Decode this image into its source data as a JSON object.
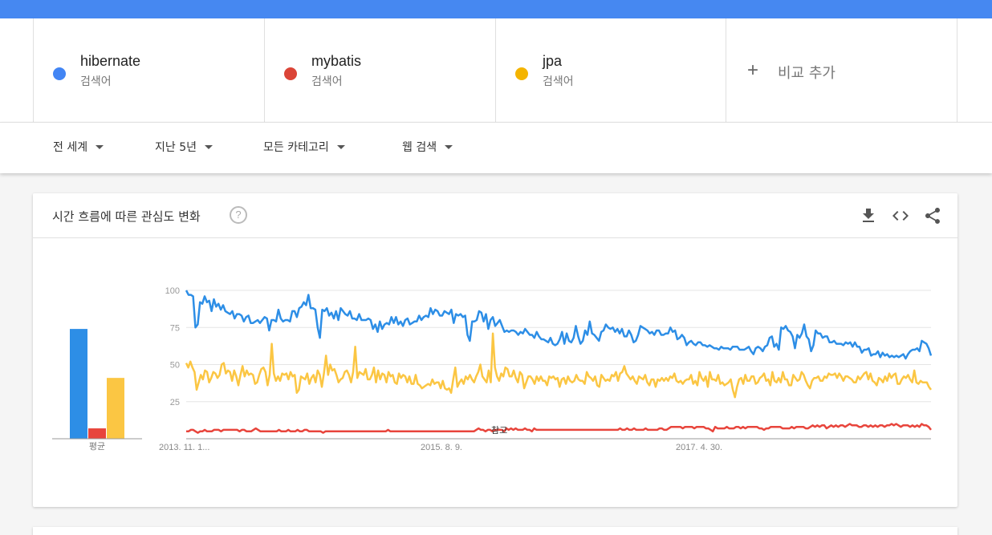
{
  "terms": [
    {
      "name": "hibernate",
      "type": "검색어",
      "color": "#4285f4"
    },
    {
      "name": "mybatis",
      "type": "검색어",
      "color": "#db4437"
    },
    {
      "name": "jpa",
      "type": "검색어",
      "color": "#f4b400"
    }
  ],
  "add_compare": {
    "plus": "+",
    "label": "비교 추가"
  },
  "filters": {
    "region": "전 세계",
    "time": "지난 5년",
    "category": "모든 카테고리",
    "search_type": "웹 검색"
  },
  "card": {
    "title": "시간 흐름에 따른 관심도 변화",
    "help": "?",
    "icons": [
      "download-icon",
      "embed-code-icon",
      "share-icon"
    ]
  },
  "chart_data": {
    "type": "line",
    "x_tick_labels": [
      "2013. 11. 1...",
      "2015. 8. 9.",
      "2017. 4. 30."
    ],
    "y_ticks": [
      25,
      50,
      75,
      100
    ],
    "ylim": [
      0,
      100
    ],
    "note_label": "참고",
    "average_label": "평균",
    "averages": [
      {
        "term": "hibernate",
        "value": 74,
        "color": "#2d8ee6"
      },
      {
        "term": "mybatis",
        "value": 7,
        "color": "#e8453c"
      },
      {
        "term": "jpa",
        "value": 41,
        "color": "#fbc643"
      }
    ],
    "series": [
      {
        "name": "hibernate",
        "color": "#2d8ee6",
        "values": [
          100,
          97,
          97,
          96,
          75,
          77,
          92,
          91,
          96,
          92,
          93,
          86,
          94,
          89,
          91,
          87,
          90,
          86,
          85,
          84,
          86,
          81,
          84,
          84,
          83,
          79,
          82,
          83,
          78,
          78,
          79,
          80,
          78,
          80,
          82,
          81,
          73,
          80,
          80,
          79,
          87,
          81,
          79,
          80,
          80,
          79,
          86,
          86,
          82,
          88,
          89,
          92,
          90,
          97,
          88,
          88,
          87,
          75,
          68,
          87,
          86,
          88,
          83,
          85,
          81,
          86,
          80,
          88,
          86,
          84,
          83,
          86,
          81,
          81,
          80,
          84,
          80,
          80,
          80,
          81,
          80,
          74,
          77,
          72,
          79,
          74,
          77,
          78,
          77,
          82,
          78,
          82,
          77,
          79,
          76,
          80,
          81,
          77,
          78,
          79,
          79,
          83,
          80,
          82,
          83,
          82,
          88,
          84,
          87,
          86,
          83,
          83,
          86,
          85,
          84,
          87,
          78,
          84,
          83,
          84,
          82,
          83,
          70,
          66,
          79,
          79,
          80,
          86,
          85,
          79,
          84,
          74,
          80,
          82,
          76,
          78,
          80,
          76,
          72,
          73,
          72,
          73,
          73,
          72,
          70,
          72,
          71,
          74,
          72,
          70,
          70,
          68,
          72,
          69,
          67,
          67,
          66,
          65,
          68,
          64,
          63,
          64,
          67,
          72,
          64,
          71,
          66,
          65,
          68,
          76,
          69,
          64,
          66,
          73,
          70,
          79,
          71,
          70,
          68,
          66,
          72,
          73,
          77,
          75,
          74,
          75,
          72,
          74,
          71,
          74,
          69,
          69,
          73,
          70,
          65,
          66,
          70,
          76,
          75,
          74,
          73,
          71,
          72,
          70,
          73,
          73,
          70,
          70,
          71,
          71,
          75,
          72,
          73,
          67,
          68,
          70,
          68,
          63,
          65,
          66,
          64,
          63,
          65,
          65,
          63,
          63,
          62,
          63,
          62,
          61,
          61,
          60,
          62,
          61,
          61,
          61,
          60,
          62,
          62,
          62,
          60,
          60,
          60,
          61,
          62,
          59,
          57,
          61,
          62,
          61,
          59,
          62,
          63,
          68,
          69,
          62,
          64,
          60,
          75,
          74,
          76,
          73,
          72,
          69,
          61,
          70,
          68,
          71,
          77,
          69,
          67,
          59,
          63,
          73,
          71,
          71,
          68,
          69,
          69,
          65,
          65,
          66,
          64,
          64,
          64,
          63,
          65,
          64,
          65,
          62,
          65,
          62,
          62,
          58,
          60,
          60,
          61,
          56,
          57,
          57,
          59,
          55,
          58,
          56,
          57,
          55,
          56,
          55,
          56,
          55,
          56,
          57,
          54,
          57,
          59,
          60,
          60,
          61,
          59,
          66,
          65,
          64,
          61,
          56
        ]
      },
      {
        "name": "mybatis",
        "color": "#e8453c",
        "values": [
          5,
          5,
          6,
          6,
          5,
          4,
          5,
          5,
          6,
          5,
          5,
          5,
          6,
          6,
          6,
          5,
          6,
          6,
          6,
          6,
          6,
          6,
          6,
          5,
          6,
          6,
          5,
          5,
          5,
          6,
          7,
          6,
          5,
          5,
          5,
          5,
          5,
          5,
          5,
          5,
          6,
          5,
          5,
          5,
          6,
          5,
          5,
          5,
          6,
          5,
          5,
          6,
          6,
          5,
          5,
          5,
          5,
          5,
          5,
          4,
          5,
          5,
          5,
          5,
          5,
          5,
          5,
          5,
          5,
          5,
          5,
          5,
          5,
          5,
          5,
          5,
          5,
          5,
          5,
          5,
          5,
          5,
          5,
          5,
          5,
          5,
          5,
          6,
          5,
          5,
          5,
          5,
          5,
          5,
          5,
          5,
          5,
          5,
          5,
          5,
          5,
          5,
          5,
          5,
          5,
          5,
          5,
          5,
          5,
          5,
          5,
          5,
          5,
          5,
          5,
          5,
          5,
          5,
          5,
          5,
          5,
          5,
          5,
          5,
          5,
          6,
          7,
          6,
          6,
          5,
          6,
          6,
          5,
          6,
          6,
          6,
          6,
          5,
          7,
          6,
          7,
          6,
          7,
          6,
          6,
          6,
          7,
          6,
          6,
          5,
          7,
          6,
          6,
          6,
          6,
          6,
          6,
          6,
          6,
          6,
          6,
          6,
          6,
          6,
          6,
          6,
          6,
          6,
          6,
          6,
          6,
          6,
          6,
          6,
          6,
          6,
          6,
          6,
          6,
          6,
          6,
          6,
          6,
          6,
          6,
          6,
          6,
          7,
          6,
          6,
          7,
          6,
          6,
          7,
          6,
          6,
          6,
          6,
          7,
          6,
          6,
          6,
          6,
          6,
          7,
          7,
          6,
          6,
          7,
          8,
          8,
          8,
          8,
          8,
          7,
          8,
          8,
          8,
          8,
          7,
          8,
          8,
          8,
          8,
          7,
          7,
          6,
          5,
          8,
          7,
          7,
          7,
          7,
          8,
          7,
          7,
          7,
          8,
          8,
          7,
          8,
          7,
          8,
          8,
          8,
          8,
          8,
          7,
          7,
          6,
          7,
          7,
          8,
          8,
          8,
          8,
          8,
          7,
          7,
          7,
          7,
          8,
          7,
          8,
          8,
          8,
          8,
          7,
          7,
          8,
          9,
          8,
          9,
          8,
          9,
          9,
          7,
          8,
          9,
          8,
          9,
          8,
          9,
          9,
          8,
          9,
          10,
          9,
          9,
          9,
          8,
          8,
          9,
          9,
          8,
          9,
          8,
          9,
          8,
          9,
          9,
          8,
          9,
          9,
          10,
          9,
          10,
          9,
          8,
          9,
          9,
          9,
          8,
          9,
          8,
          9,
          8,
          10,
          9,
          9,
          8,
          6
        ]
      },
      {
        "name": "jpa",
        "color": "#fbc643",
        "values": [
          51,
          48,
          52,
          48,
          45,
          33,
          38,
          43,
          40,
          46,
          45,
          38,
          41,
          45,
          44,
          41,
          43,
          50,
          51,
          44,
          46,
          45,
          39,
          46,
          42,
          36,
          43,
          49,
          42,
          46,
          43,
          44,
          43,
          37,
          38,
          43,
          47,
          48,
          45,
          36,
          43,
          64,
          44,
          39,
          42,
          39,
          44,
          43,
          44,
          40,
          45,
          42,
          43,
          31,
          33,
          42,
          41,
          40,
          44,
          37,
          41,
          43,
          38,
          46,
          43,
          35,
          44,
          56,
          43,
          50,
          46,
          47,
          43,
          38,
          40,
          41,
          45,
          46,
          43,
          38,
          45,
          62,
          41,
          45,
          44,
          43,
          47,
          40,
          40,
          43,
          48,
          38,
          46,
          40,
          44,
          43,
          38,
          45,
          42,
          43,
          38,
          37,
          44,
          41,
          43,
          42,
          38,
          42,
          37,
          37,
          43,
          37,
          36,
          34,
          35,
          36,
          37,
          36,
          40,
          37,
          38,
          38,
          34,
          39,
          34,
          33,
          34,
          31,
          40,
          48,
          35,
          38,
          40,
          37,
          42,
          40,
          43,
          40,
          38,
          42,
          45,
          50,
          42,
          40,
          38,
          46,
          38,
          71,
          48,
          42,
          39,
          44,
          42,
          48,
          47,
          42,
          42,
          46,
          41,
          38,
          45,
          43,
          34,
          38,
          42,
          42,
          40,
          37,
          42,
          39,
          42,
          39,
          39,
          36,
          42,
          41,
          42,
          40,
          41,
          35,
          40,
          41,
          37,
          42,
          39,
          38,
          39,
          43,
          40,
          39,
          39,
          37,
          45,
          42,
          41,
          39,
          42,
          36,
          35,
          43,
          41,
          39,
          40,
          39,
          43,
          42,
          45,
          39,
          44,
          45,
          49,
          44,
          42,
          40,
          42,
          39,
          37,
          42,
          41,
          40,
          43,
          38,
          36,
          40,
          40,
          35,
          40,
          39,
          41,
          39,
          41,
          39,
          42,
          41,
          44,
          39,
          38,
          39,
          37,
          39,
          40,
          40,
          43,
          37,
          39,
          36,
          45,
          41,
          39,
          42,
          35,
          45,
          40,
          40,
          39,
          43,
          37,
          38,
          36,
          37,
          38,
          40,
          33,
          28,
          35,
          40,
          41,
          37,
          43,
          39,
          39,
          42,
          42,
          37,
          38,
          41,
          42,
          44,
          39,
          40,
          36,
          45,
          39,
          38,
          41,
          38,
          45,
          40,
          40,
          36,
          36,
          43,
          41,
          39,
          40,
          45,
          43,
          39,
          36,
          34,
          39,
          41,
          41,
          42,
          39,
          39,
          42,
          41,
          44,
          43,
          43,
          44,
          41,
          44,
          42,
          39,
          42,
          42,
          41,
          40,
          38,
          38,
          42,
          40,
          42,
          44,
          45,
          40,
          44,
          39,
          38,
          36,
          41,
          40,
          38,
          42,
          39,
          44,
          41,
          43,
          44,
          37,
          37,
          40,
          42,
          41,
          43,
          40,
          38,
          46,
          38,
          37,
          39,
          38,
          38,
          38,
          35,
          33
        ]
      }
    ]
  }
}
